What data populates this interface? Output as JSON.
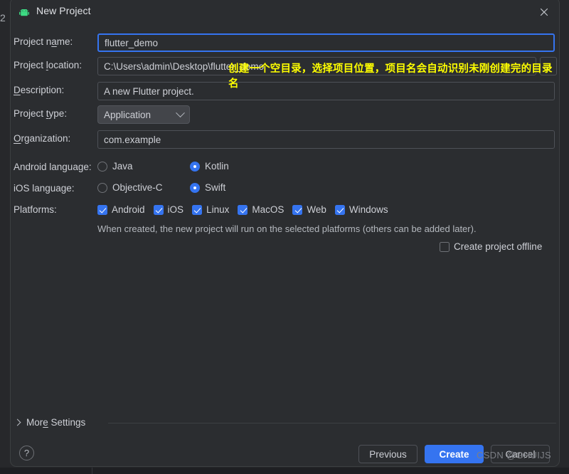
{
  "window": {
    "title": "New Project",
    "app_icon": "android-robot-icon",
    "close_icon": "close-icon"
  },
  "background": {
    "left_char": "2"
  },
  "form": {
    "project_name": {
      "label": "Project name:",
      "mnemonic": "a",
      "value": "flutter_demo",
      "focused": true
    },
    "project_location": {
      "label": "Project location:",
      "mnemonic": "l",
      "value": "C:\\Users\\admin\\Desktop\\flutter_demo",
      "browse_label": "..."
    },
    "description": {
      "label": "Description:",
      "mnemonic": "D",
      "value": "A new Flutter project."
    },
    "project_type": {
      "label": "Project type:",
      "mnemonic": "t",
      "value": "Application",
      "options": [
        "Application"
      ]
    },
    "organization": {
      "label": "Organization:",
      "mnemonic": "O",
      "value": "com.example"
    },
    "android_language": {
      "label": "Android language:",
      "options": [
        {
          "label": "Java",
          "selected": false
        },
        {
          "label": "Kotlin",
          "selected": true
        }
      ]
    },
    "ios_language": {
      "label": "iOS language:",
      "options": [
        {
          "label": "Objective-C",
          "selected": false
        },
        {
          "label": "Swift",
          "selected": true
        }
      ]
    },
    "platforms": {
      "label": "Platforms:",
      "options": [
        {
          "label": "Android",
          "checked": true
        },
        {
          "label": "iOS",
          "checked": true
        },
        {
          "label": "Linux",
          "checked": true
        },
        {
          "label": "MacOS",
          "checked": true
        },
        {
          "label": "Web",
          "checked": true
        },
        {
          "label": "Windows",
          "checked": true
        }
      ]
    },
    "platforms_hint": "When created, the new project will run on the selected platforms (others can be added later).",
    "create_offline": {
      "label": "Create project offline",
      "checked": false
    }
  },
  "annotation": {
    "text": "创建一个空目录，选择项目位置，项目名会自动识别未刚创建完的目录名",
    "color": "#ffff00"
  },
  "more_settings": {
    "label_before": "Mor",
    "mnemonic": "e",
    "label_after": " Settings",
    "expanded": false
  },
  "footer": {
    "help_label": "?",
    "previous_label": "Previous",
    "create_label": "Create",
    "cancel_label": "Cancel"
  },
  "watermark": {
    "text": "CSDN @GHUIJS"
  },
  "colors": {
    "accent": "#3574f0",
    "dialog_bg": "#2b2d30",
    "page_bg": "#27282b",
    "text": "#ced0d6",
    "annotation": "#ffff00"
  }
}
